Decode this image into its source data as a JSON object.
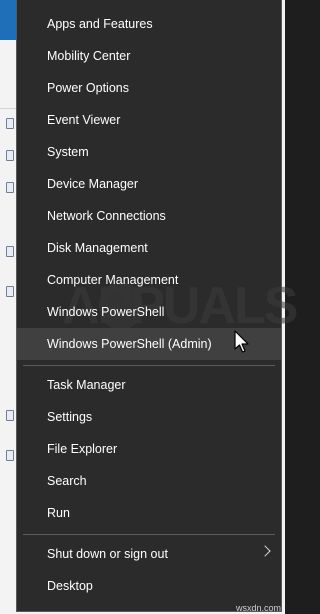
{
  "menu": {
    "items": [
      {
        "label": "Apps and Features"
      },
      {
        "label": "Mobility Center"
      },
      {
        "label": "Power Options"
      },
      {
        "label": "Event Viewer"
      },
      {
        "label": "System"
      },
      {
        "label": "Device Manager"
      },
      {
        "label": "Network Connections"
      },
      {
        "label": "Disk Management"
      },
      {
        "label": "Computer Management"
      },
      {
        "label": "Windows PowerShell"
      },
      {
        "label": "Windows PowerShell (Admin)"
      },
      {
        "label": "Task Manager"
      },
      {
        "label": "Settings"
      },
      {
        "label": "File Explorer"
      },
      {
        "label": "Search"
      },
      {
        "label": "Run"
      },
      {
        "label": "Shut down or sign out"
      },
      {
        "label": "Desktop"
      }
    ],
    "hovered_item": "Windows PowerShell (Admin)"
  },
  "watermark": {
    "text": "APPUALS"
  },
  "site_mark": {
    "text": "wsxdn.com"
  },
  "colors": {
    "menu_background": "#2b2b2b",
    "menu_text": "#ffffff",
    "hover_background": "#404040",
    "separator": "#5c5c5c"
  }
}
